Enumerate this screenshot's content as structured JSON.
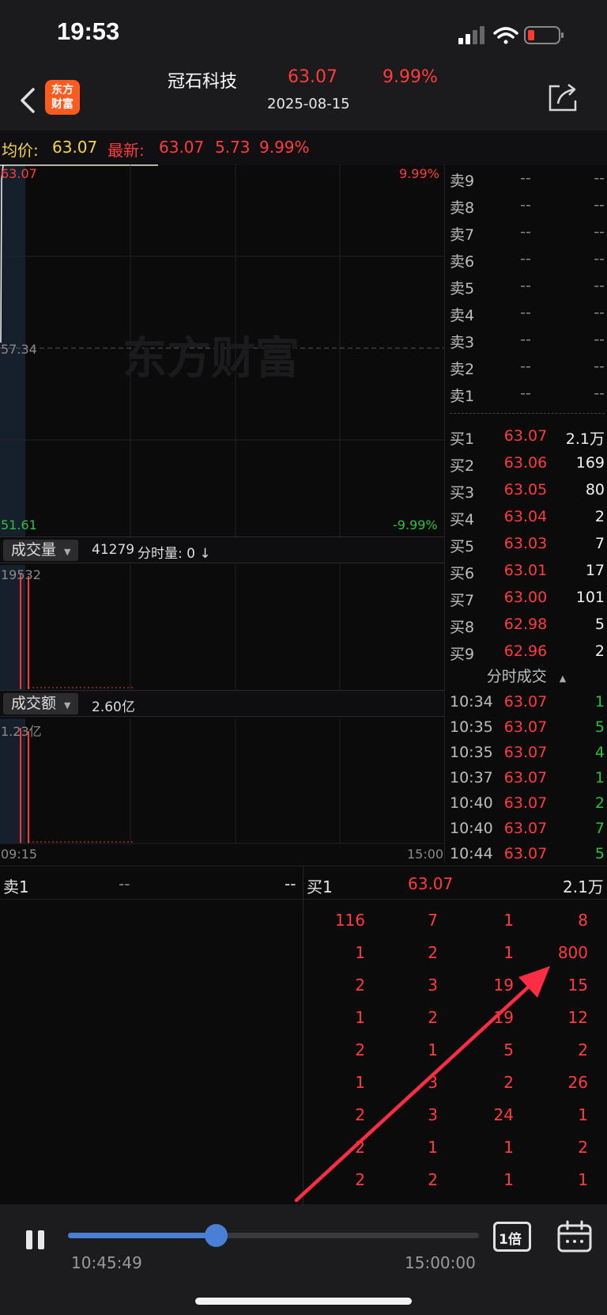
{
  "status": {
    "time": "19:53"
  },
  "header": {
    "logo_line1": "东方",
    "logo_line2": "财富",
    "stock_name": "冠石科技",
    "price": "63.07",
    "pct": "9.99%",
    "date": "2025-08-15"
  },
  "info": {
    "avg_label": "均价:",
    "avg_value": "63.07",
    "latest_label": "最新:",
    "latest_value": "63.07",
    "change": "5.73",
    "change_pct": "9.99%"
  },
  "chart": {
    "price_high": "63.07",
    "pct_high": "9.99%",
    "price_mid": "57.34",
    "price_low": "51.61",
    "pct_low": "-9.99%",
    "watermark": "东方财富",
    "volume_label": "成交量",
    "volume_total": "41279",
    "volume_sub": "分时量: 0 ↓",
    "volume_max": "19532",
    "amount_label": "成交额",
    "amount_total": "2.60亿",
    "amount_max": "1.23亿",
    "time_start": "09:15",
    "time_end": "15:00"
  },
  "sell_orders": [
    {
      "label": "卖9",
      "price": "--",
      "vol": "--"
    },
    {
      "label": "卖8",
      "price": "--",
      "vol": "--"
    },
    {
      "label": "卖7",
      "price": "--",
      "vol": "--"
    },
    {
      "label": "卖6",
      "price": "--",
      "vol": "--"
    },
    {
      "label": "卖5",
      "price": "--",
      "vol": "--"
    },
    {
      "label": "卖4",
      "price": "--",
      "vol": "--"
    },
    {
      "label": "卖3",
      "price": "--",
      "vol": "--"
    },
    {
      "label": "卖2",
      "price": "--",
      "vol": "--"
    },
    {
      "label": "卖1",
      "price": "--",
      "vol": "--"
    }
  ],
  "buy_orders": [
    {
      "label": "买1",
      "price": "63.07",
      "vol": "2.1万"
    },
    {
      "label": "买2",
      "price": "63.06",
      "vol": "169"
    },
    {
      "label": "买3",
      "price": "63.05",
      "vol": "80"
    },
    {
      "label": "买4",
      "price": "63.04",
      "vol": "2"
    },
    {
      "label": "买5",
      "price": "63.03",
      "vol": "7"
    },
    {
      "label": "买6",
      "price": "63.01",
      "vol": "17"
    },
    {
      "label": "买7",
      "price": "63.00",
      "vol": "101"
    },
    {
      "label": "买8",
      "price": "62.98",
      "vol": "5"
    },
    {
      "label": "买9",
      "price": "62.96",
      "vol": "2"
    }
  ],
  "trades_title": "分时成交",
  "trades": [
    {
      "time": "10:34",
      "price": "63.07",
      "vol": "1"
    },
    {
      "time": "10:35",
      "price": "63.07",
      "vol": "5"
    },
    {
      "time": "10:35",
      "price": "63.07",
      "vol": "4"
    },
    {
      "time": "10:37",
      "price": "63.07",
      "vol": "1"
    },
    {
      "time": "10:40",
      "price": "63.07",
      "vol": "2"
    },
    {
      "time": "10:40",
      "price": "63.07",
      "vol": "7"
    },
    {
      "time": "10:44",
      "price": "63.07",
      "vol": "5"
    }
  ],
  "queue": {
    "sell_label": "卖1",
    "sell_price": "--",
    "sell_vol": "--",
    "buy_label": "买1",
    "buy_price": "63.07",
    "buy_vol": "2.1万",
    "rows": [
      [
        "116",
        "7",
        "1",
        "8"
      ],
      [
        "1",
        "2",
        "1",
        "800"
      ],
      [
        "2",
        "3",
        "19",
        "15"
      ],
      [
        "1",
        "2",
        "19",
        "12"
      ],
      [
        "2",
        "1",
        "5",
        "2"
      ],
      [
        "1",
        "3",
        "2",
        "26"
      ],
      [
        "2",
        "3",
        "24",
        "1"
      ],
      [
        "2",
        "1",
        "1",
        "2"
      ],
      [
        "2",
        "2",
        "1",
        "1"
      ]
    ]
  },
  "playback": {
    "current_time": "10:45:49",
    "end_time": "15:00:00",
    "speed": "1倍",
    "progress": 0.36
  }
}
